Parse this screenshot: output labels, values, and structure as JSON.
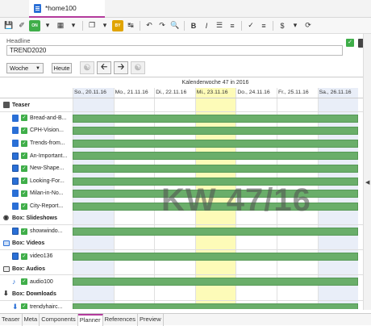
{
  "tab": {
    "title": "*home100"
  },
  "headline": {
    "label": "Headline",
    "value": "TREND2020"
  },
  "toolbar": {
    "tag_on": "ON",
    "tag_by": "BY"
  },
  "controls": {
    "view_select": "Woche",
    "today_label": "Heute"
  },
  "calendar": {
    "week_title": "Kalenderwoche 47 in 2016",
    "watermark": "KW 47/16",
    "days": [
      "So., 20.11.16",
      "Mo., 21.11.16",
      "Di., 22.11.16",
      "Mi., 23.11.16",
      "Do., 24.11.16",
      "Fr., 25.11.16",
      "Sa., 26.11.16"
    ],
    "highlight_day_index": 3,
    "highlight_color": "#fdfbb8",
    "weekend_color": "#e9eef8"
  },
  "sections": [
    {
      "name": "Teaser",
      "items": [
        "Bread-and-B...",
        "CPH-Vision...",
        "Trends-from...",
        "An-Important...",
        "New-Shape...",
        "Looking-For...",
        "Milan-in-No...",
        "City-Report..."
      ]
    },
    {
      "name": "Box: Slideshows",
      "items": [
        "showwindo..."
      ]
    },
    {
      "name": "Box: Videos",
      "items": [
        "video136"
      ]
    },
    {
      "name": "Box: Audios",
      "items": [
        "audio100"
      ]
    },
    {
      "name": "Box: Downloads",
      "items": [
        "trendyhairc..."
      ]
    }
  ],
  "bottom_tabs": [
    "Teaser",
    "Meta",
    "Components",
    "Planner",
    "References",
    "Preview"
  ],
  "active_bottom_tab": "Planner",
  "colors": {
    "accent": "#b33b9c",
    "bar": "#6aae6a",
    "icon_blue": "#2a6fd6",
    "check_green": "#3fae49"
  }
}
